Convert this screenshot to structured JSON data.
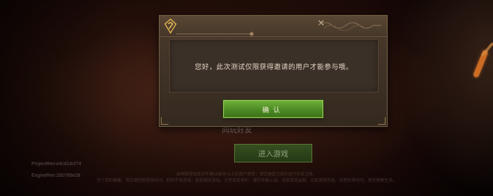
{
  "background": {
    "friend_label": "同玩好友",
    "enter_button_label": "进入游戏",
    "project_rev": "ProjectRev:e4cd14cf74",
    "engine_rev": "EngineRev:260785e28",
    "footer_lines": [
      "本网络游戏适合年满16周岁以上的用户使用；请您确定已如实进行实名注册。",
      "为了您的健康，请合理控制游戏时间。抵制不良游戏，拒绝盗版游戏。注意自我保护，谨防受骗上当。适度游戏益脑，沉迷游戏伤身。合理安排时间，享受健康生活。"
    ]
  },
  "dialog": {
    "emblem_icon": "rune-emblem-icon",
    "message": "您好，此次测试仅限获得邀请的用户才能参与哦。",
    "confirm_label": "确认"
  },
  "colors": {
    "confirm_green": "#4b8a24",
    "accent_orange": "#e87a2a",
    "dialog_brown": "#3d3025"
  }
}
